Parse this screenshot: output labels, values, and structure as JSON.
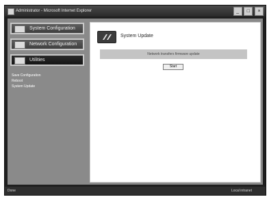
{
  "window": {
    "title": "Administrator - Microsoft Internet Explorer",
    "controls": [
      "_",
      "□",
      "×"
    ]
  },
  "sidebar": {
    "buttons": [
      {
        "label": "System Configuration",
        "icon": "monitor-icon"
      },
      {
        "label": "Network Configuration",
        "icon": "network-icon"
      },
      {
        "label": "Utilities",
        "icon": "tools-icon"
      }
    ],
    "submenu": [
      "Save Configuration",
      "Reboot",
      "System Update"
    ]
  },
  "main": {
    "title": "System Update",
    "info": "Network transfers firmware update",
    "start_button": "Start"
  },
  "statusbar": {
    "left": "Done",
    "right": "Local intranet"
  },
  "colors": {
    "background": "#8a8a8a",
    "panel": "#ffffff",
    "info_bar": "#c4c4c4",
    "titlebar": "#2a2a2a"
  }
}
